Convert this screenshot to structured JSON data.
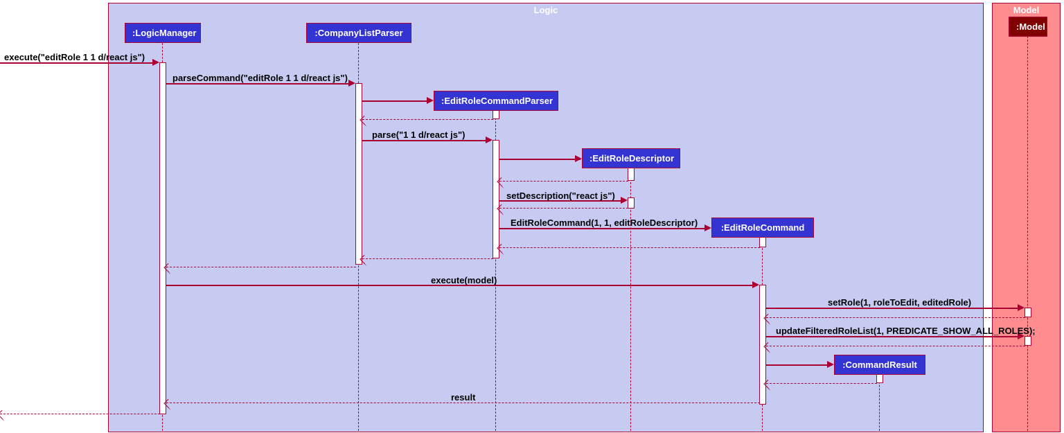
{
  "frames": {
    "logic": "Logic",
    "model": "Model"
  },
  "participants": {
    "logicManager": ":LogicManager",
    "companyListParser": ":CompanyListParser",
    "editRoleCommandParser": ":EditRoleCommandParser",
    "editRoleDescriptor": ":EditRoleDescriptor",
    "editRoleCommand": ":EditRoleCommand",
    "commandResult": ":CommandResult",
    "model": ":Model"
  },
  "messages": {
    "m1": "execute(\"editRole 1 1 d/react js\")",
    "m2": "parseCommand(\"editRole 1 1 d/react js\")",
    "m3": "parse(\"1 1 d/react js\")",
    "m4": "setDescription(\"react js\")",
    "m5": "EditRoleCommand(1, 1, editRoleDescriptor)",
    "m6": "execute(model)",
    "m7": "setRole(1, roleToEdit, editedRole)",
    "m8": "updateFilteredRoleList(1, PREDICATE_SHOW_ALL_ROLES);",
    "m9": "result"
  }
}
